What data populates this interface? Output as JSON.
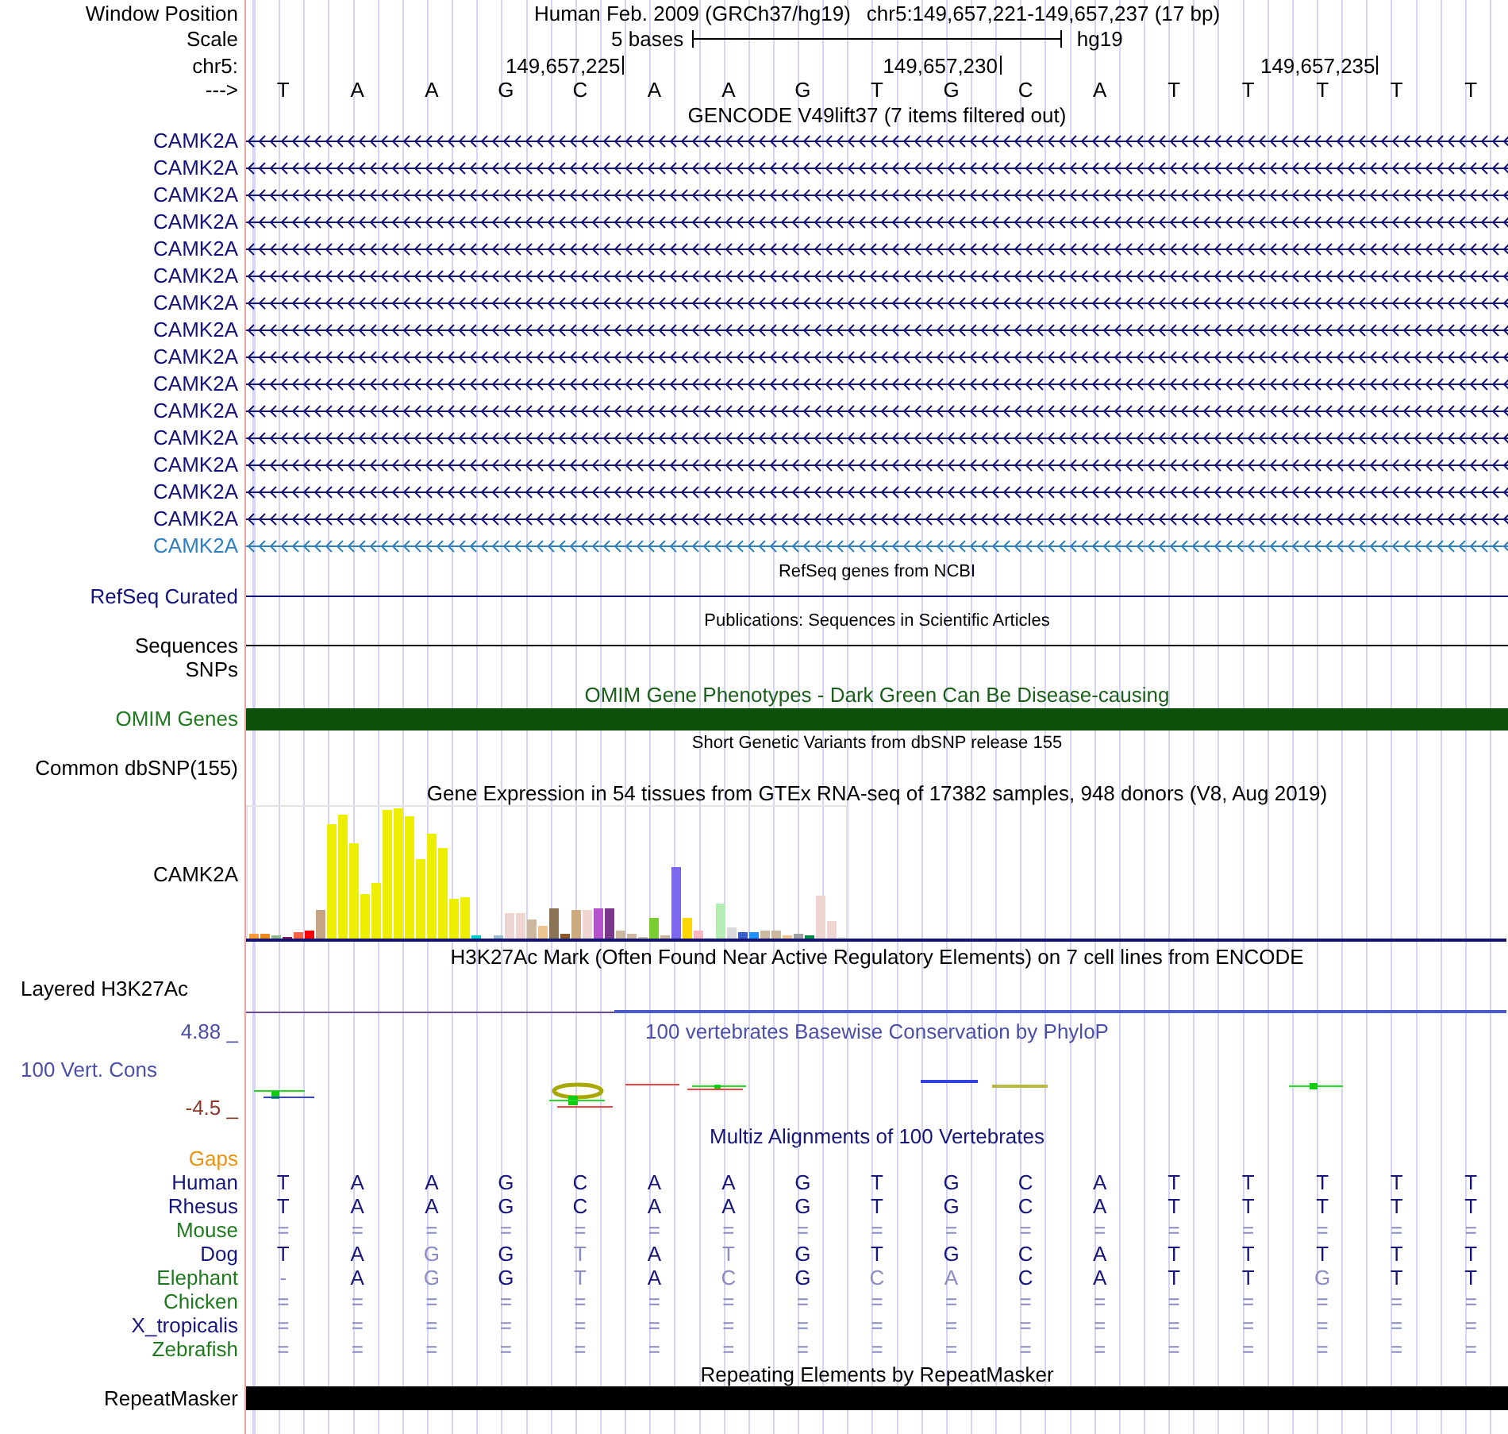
{
  "window_position": {
    "label": "Window Position",
    "assembly": "Human Feb. 2009 (GRCh37/hg19)",
    "range": "chr5:149,657,221-149,657,237 (17 bp)"
  },
  "scale": {
    "label": "Scale",
    "length": "5 bases",
    "assembly": "hg19"
  },
  "ruler": {
    "label": "chr5:",
    "ticks": [
      "149,657,225",
      "149,657,230",
      "149,657,235"
    ]
  },
  "sequence": {
    "label": "--->",
    "bases": [
      "T",
      "A",
      "A",
      "G",
      "C",
      "A",
      "A",
      "G",
      "T",
      "G",
      "C",
      "A",
      "T",
      "T",
      "T",
      "T",
      "T"
    ]
  },
  "gencode": {
    "title": "GENCODE V49lift37 (7 items filtered out)",
    "transcripts": [
      {
        "name": "CAMK2A",
        "highlighted": false
      },
      {
        "name": "CAMK2A",
        "highlighted": false
      },
      {
        "name": "CAMK2A",
        "highlighted": false
      },
      {
        "name": "CAMK2A",
        "highlighted": false
      },
      {
        "name": "CAMK2A",
        "highlighted": false
      },
      {
        "name": "CAMK2A",
        "highlighted": false
      },
      {
        "name": "CAMK2A",
        "highlighted": false
      },
      {
        "name": "CAMK2A",
        "highlighted": false
      },
      {
        "name": "CAMK2A",
        "highlighted": false
      },
      {
        "name": "CAMK2A",
        "highlighted": false
      },
      {
        "name": "CAMK2A",
        "highlighted": false
      },
      {
        "name": "CAMK2A",
        "highlighted": false
      },
      {
        "name": "CAMK2A",
        "highlighted": false
      },
      {
        "name": "CAMK2A",
        "highlighted": false
      },
      {
        "name": "CAMK2A",
        "highlighted": false
      },
      {
        "name": "CAMK2A",
        "highlighted": true
      }
    ]
  },
  "refseq": {
    "title": "RefSeq genes from NCBI",
    "label": "RefSeq Curated"
  },
  "publications": {
    "title": "Publications: Sequences in Scientific Articles",
    "label": "Sequences"
  },
  "snps": {
    "label": "SNPs"
  },
  "omim": {
    "title": "OMIM Gene Phenotypes - Dark Green Can Be Disease-causing",
    "label": "OMIM Genes"
  },
  "dbsnp": {
    "title": "Short Genetic Variants from dbSNP release 155",
    "label": "Common dbSNP(155)"
  },
  "gtex": {
    "title": "Gene Expression in 54 tissues from GTEx RNA-seq of 17382 samples, 948 donors (V8, Aug 2019)",
    "label": "CAMK2A"
  },
  "h3k27ac": {
    "title": "H3K27Ac Mark (Often Found Near Active Regulatory Elements) on 7 cell lines from ENCODE",
    "label": "Layered H3K27Ac"
  },
  "conservation": {
    "title": "100 vertebrates Basewise Conservation by PhyloP",
    "label": "100 Vert. Cons",
    "max": "4.88 _",
    "min": "-4.5 _"
  },
  "multiz": {
    "title": "Multiz Alignments of 100 Vertebrates",
    "species": [
      {
        "name": "Gaps",
        "color": "#e8920e"
      },
      {
        "name": "Human",
        "color": "#16167a",
        "bases": [
          "T",
          "A",
          "A",
          "G",
          "C",
          "A",
          "A",
          "G",
          "T",
          "G",
          "C",
          "A",
          "T",
          "T",
          "T",
          "T",
          "T"
        ],
        "faded": [
          false,
          false,
          false,
          false,
          false,
          false,
          false,
          false,
          false,
          false,
          false,
          false,
          false,
          false,
          false,
          false,
          false
        ]
      },
      {
        "name": "Rhesus",
        "color": "#16167a",
        "bases": [
          "T",
          "A",
          "A",
          "G",
          "C",
          "A",
          "A",
          "G",
          "T",
          "G",
          "C",
          "A",
          "T",
          "T",
          "T",
          "T",
          "T"
        ],
        "faded": [
          false,
          false,
          false,
          false,
          false,
          false,
          false,
          false,
          false,
          false,
          false,
          false,
          false,
          false,
          false,
          false,
          false
        ]
      },
      {
        "name": "Mouse",
        "color": "#1f7a1f",
        "bases": [
          "=",
          "=",
          "=",
          "=",
          "=",
          "=",
          "=",
          "=",
          "=",
          "=",
          "=",
          "=",
          "=",
          "=",
          "=",
          "=",
          "="
        ],
        "faded": [
          true,
          true,
          true,
          true,
          true,
          true,
          true,
          true,
          true,
          true,
          true,
          true,
          true,
          true,
          true,
          true,
          true
        ]
      },
      {
        "name": "Dog",
        "color": "#16167a",
        "bases": [
          "T",
          "A",
          "G",
          "G",
          "T",
          "A",
          "T",
          "G",
          "T",
          "G",
          "C",
          "A",
          "T",
          "T",
          "T",
          "T",
          "T"
        ],
        "faded": [
          false,
          false,
          true,
          false,
          true,
          false,
          true,
          false,
          false,
          false,
          false,
          false,
          false,
          false,
          false,
          false,
          false
        ]
      },
      {
        "name": "Elephant",
        "color": "#1f7a1f",
        "bases": [
          "-",
          "A",
          "G",
          "G",
          "T",
          "A",
          "C",
          "G",
          "C",
          "A",
          "C",
          "A",
          "T",
          "T",
          "G",
          "T",
          "T"
        ],
        "faded": [
          true,
          false,
          true,
          false,
          true,
          false,
          true,
          false,
          true,
          true,
          false,
          false,
          false,
          false,
          true,
          false,
          false
        ]
      },
      {
        "name": "Chicken",
        "color": "#1f7a1f",
        "bases": [
          "=",
          "=",
          "=",
          "=",
          "=",
          "=",
          "=",
          "=",
          "=",
          "=",
          "=",
          "=",
          "=",
          "=",
          "=",
          "=",
          "="
        ],
        "faded": [
          true,
          true,
          true,
          true,
          true,
          true,
          true,
          true,
          true,
          true,
          true,
          true,
          true,
          true,
          true,
          true,
          true
        ]
      },
      {
        "name": "X_tropicalis",
        "color": "#16167a",
        "bases": [
          "=",
          "=",
          "=",
          "=",
          "=",
          "=",
          "=",
          "=",
          "=",
          "=",
          "=",
          "=",
          "=",
          "=",
          "=",
          "=",
          "="
        ],
        "faded": [
          true,
          true,
          true,
          true,
          true,
          true,
          true,
          true,
          true,
          true,
          true,
          true,
          true,
          true,
          true,
          true,
          true
        ]
      },
      {
        "name": "Zebrafish",
        "color": "#1f7a1f",
        "bases": [
          "=",
          "=",
          "=",
          "=",
          "=",
          "=",
          "=",
          "=",
          "=",
          "=",
          "=",
          "=",
          "=",
          "=",
          "=",
          "=",
          "="
        ],
        "faded": [
          true,
          true,
          true,
          true,
          true,
          true,
          true,
          true,
          true,
          true,
          true,
          true,
          true,
          true,
          true,
          true,
          true
        ]
      }
    ]
  },
  "repeatmasker": {
    "title": "Repeating Elements by RepeatMasker",
    "label": "RepeatMasker"
  }
}
